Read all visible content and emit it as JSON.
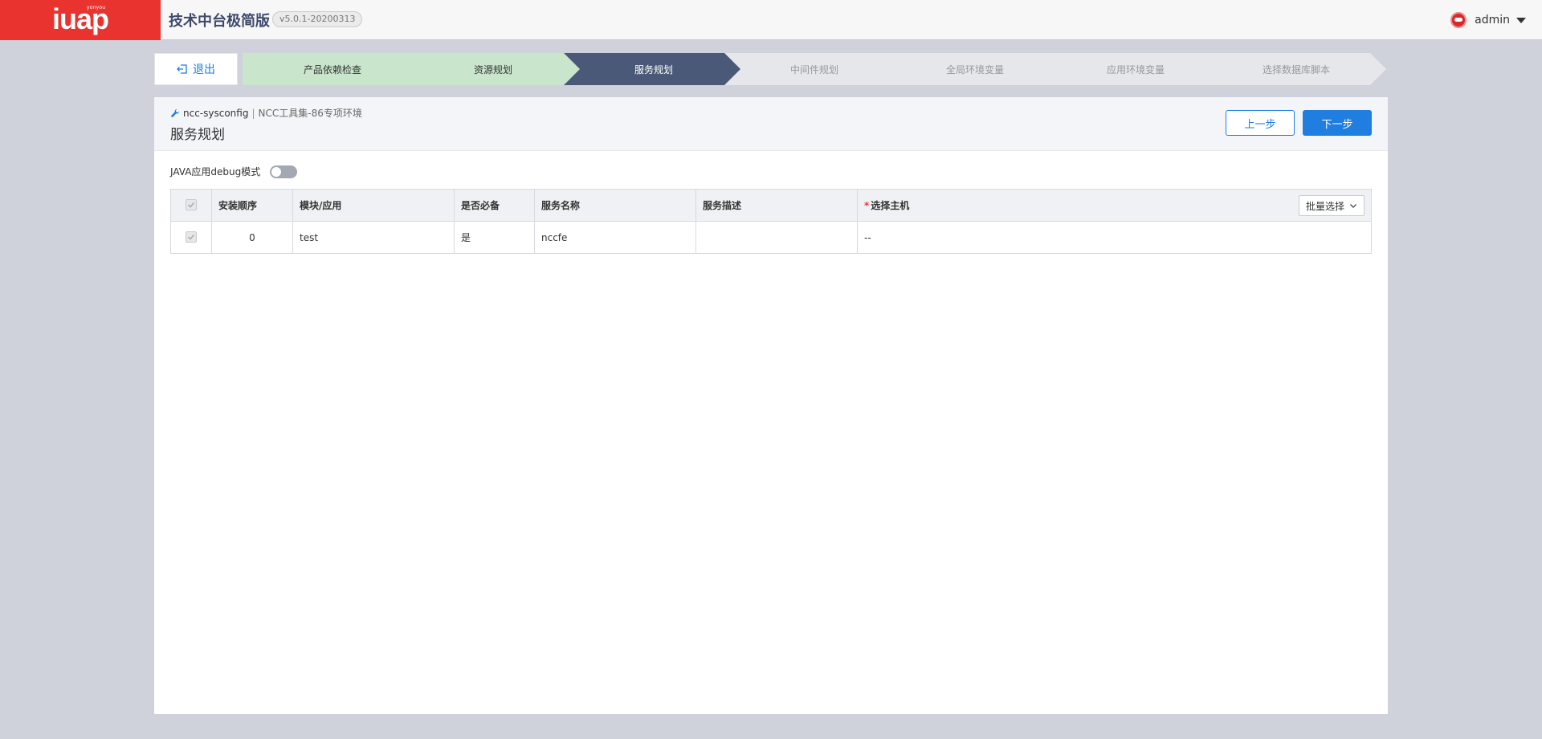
{
  "header": {
    "logo_text": "iuap",
    "logo_brand": "yonyou",
    "title": "技术中台极简版",
    "version": "v5.0.1-20200313",
    "user_name": "admin"
  },
  "nav": {
    "exit_label": "退出",
    "steps": [
      {
        "label": "产品依赖检查",
        "state": "done"
      },
      {
        "label": "资源规划",
        "state": "done"
      },
      {
        "label": "服务规划",
        "state": "active"
      },
      {
        "label": "中间件规划",
        "state": "todo"
      },
      {
        "label": "全局环境变量",
        "state": "todo"
      },
      {
        "label": "应用环境变量",
        "state": "todo"
      },
      {
        "label": "选择数据库脚本",
        "state": "todo"
      }
    ]
  },
  "panel": {
    "crumb_name": "ncc-sysconfig",
    "crumb_sep": "|",
    "crumb_env": "NCC工具集-86专项环境",
    "title": "服务规划",
    "prev_label": "上一步",
    "next_label": "下一步",
    "debug_label": "JAVA应用debug模式",
    "debug_on": false
  },
  "table": {
    "columns": [
      "安装顺序",
      "模块/应用",
      "是否必备",
      "服务名称",
      "服务描述",
      "选择主机"
    ],
    "required_mark": "*",
    "batch_label": "批量选择",
    "rows": [
      {
        "order": "0",
        "module": "test",
        "required": "是",
        "service": "nccfe",
        "desc": "",
        "host": "--"
      }
    ]
  },
  "colors": {
    "brand_red": "#e8332f",
    "primary_blue": "#1f7ee0",
    "step_done": "#c9e6cd",
    "step_active": "#4a5978",
    "step_todo": "#e6e7eb"
  }
}
